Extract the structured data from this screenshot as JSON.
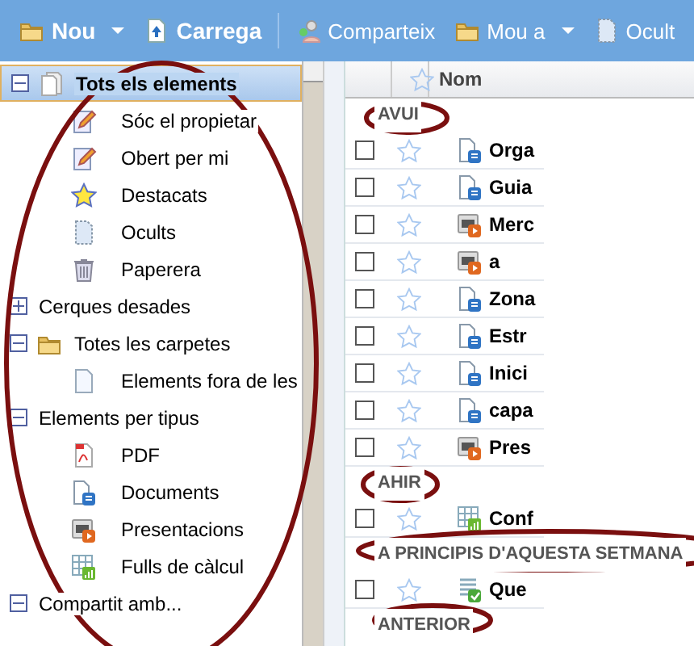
{
  "toolbar": [
    {
      "label": "Nou",
      "kind": "folder",
      "bold": true,
      "menu": true
    },
    {
      "label": "Carrega",
      "kind": "upload",
      "bold": true,
      "menu": false
    },
    {
      "label": "Comparteix",
      "kind": "people",
      "bold": false,
      "menu": false
    },
    {
      "label": "Mou a",
      "kind": "folder",
      "bold": false,
      "menu": true
    },
    {
      "label": "Ocult",
      "kind": "hidden",
      "bold": false,
      "menu": false
    }
  ],
  "sidebar": {
    "items": [
      {
        "label": "Tots els elements",
        "kind": "pages",
        "expanded": true,
        "selected": true,
        "children": [
          {
            "label": "Sóc el propietar",
            "kind": "edit",
            "selected": false
          },
          {
            "label": "Obert per mi",
            "kind": "edit",
            "selected": false
          },
          {
            "label": "Destacats",
            "kind": "star",
            "selected": false
          },
          {
            "label": "Ocults",
            "kind": "hidden",
            "selected": false
          },
          {
            "label": "Paperera",
            "kind": "trash",
            "selected": false
          }
        ]
      },
      {
        "label": "Cerques desades",
        "expanded": false,
        "selected": false
      },
      {
        "label": "Totes les carpetes",
        "kind": "folder",
        "expanded": true,
        "selected": false,
        "children": [
          {
            "label": "Elements fora de les",
            "kind": "page",
            "selected": false
          }
        ]
      },
      {
        "label": "Elements per tipus",
        "expanded": true,
        "selected": false,
        "children": [
          {
            "label": "PDF",
            "kind": "pdf",
            "selected": false
          },
          {
            "label": "Documents",
            "kind": "doc",
            "selected": false
          },
          {
            "label": "Presentacions",
            "kind": "pres",
            "selected": false
          },
          {
            "label": "Fulls de càlcul",
            "kind": "sheet",
            "selected": false
          }
        ]
      },
      {
        "label": "Compartit amb...",
        "expanded": true,
        "selected": false
      }
    ]
  },
  "list": {
    "header": {
      "name": "Nom"
    },
    "groups": [
      {
        "label": "AVUI",
        "rows": [
          {
            "name": "Orga",
            "kind": "doc",
            "checked": false,
            "starred": false
          },
          {
            "name": "Guia",
            "kind": "doc",
            "checked": false,
            "starred": false
          },
          {
            "name": "Merc",
            "kind": "pres",
            "checked": false,
            "starred": false
          },
          {
            "name": "a",
            "kind": "pres",
            "checked": false,
            "starred": false
          },
          {
            "name": "Zona",
            "kind": "doc",
            "checked": false,
            "starred": false
          },
          {
            "name": "Estr",
            "kind": "doc",
            "checked": false,
            "starred": false
          },
          {
            "name": "Inici",
            "kind": "doc",
            "checked": false,
            "starred": false
          },
          {
            "name": "capa",
            "kind": "doc",
            "checked": false,
            "starred": false
          },
          {
            "name": "Pres",
            "kind": "pres",
            "checked": false,
            "starred": false
          }
        ]
      },
      {
        "label": "AHIR",
        "rows": [
          {
            "name": "Conf",
            "kind": "sheet",
            "checked": false,
            "starred": false
          }
        ]
      },
      {
        "label": "A PRINCIPIS D'AQUESTA SETMANA",
        "rows": [
          {
            "name": "Que",
            "kind": "form",
            "checked": false,
            "starred": false
          }
        ]
      },
      {
        "label": "ANTERIOR"
      }
    ]
  }
}
